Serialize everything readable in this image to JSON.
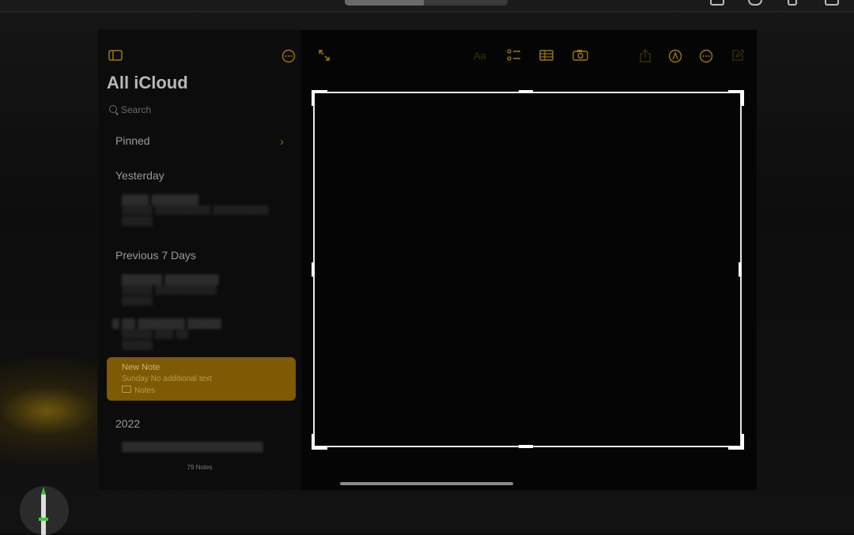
{
  "sidebar": {
    "title": "All iCloud",
    "search_placeholder": "Search",
    "sections": {
      "pinned": "Pinned",
      "yesterday": "Yesterday",
      "previous_7_days": "Previous 7 Days",
      "year_2022": "2022"
    },
    "selected_note": {
      "title": "New Note",
      "subtitle": "Sunday  No additional text",
      "folder": "Notes"
    },
    "count": "79 Notes"
  },
  "toolbar": {
    "icons": [
      "sidebar-toggle-icon",
      "more-icon",
      "expand-icon",
      "format-icon",
      "checklist-icon",
      "table-icon",
      "camera-icon",
      "share-icon",
      "markup-icon",
      "more-icon",
      "compose-icon"
    ]
  },
  "colors": {
    "accent": "#a07a08",
    "selection": "#7d5a03"
  }
}
